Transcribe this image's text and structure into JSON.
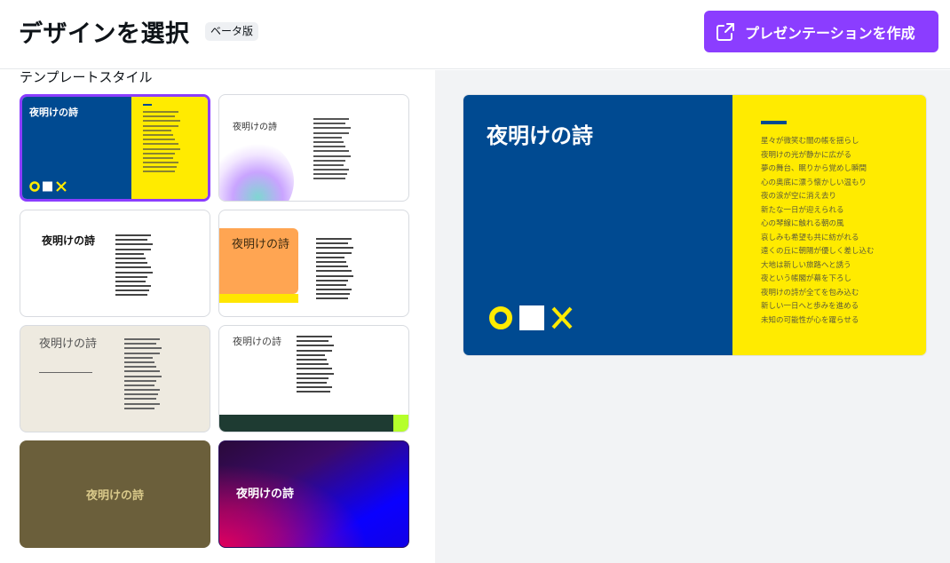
{
  "header": {
    "title": "デザインを選択",
    "beta_label": "ベータ版",
    "create_button_label": "プレゼンテーションを作成"
  },
  "left_panel": {
    "section_label": "テンプレートスタイル",
    "templates": [
      {
        "title": "夜明けの詩",
        "selected": true
      },
      {
        "title": "夜明けの詩",
        "selected": false
      },
      {
        "title": "夜明けの詩",
        "selected": false
      },
      {
        "title": "夜明けの詩",
        "selected": false
      },
      {
        "title": "夜明けの詩",
        "selected": false
      },
      {
        "title": "夜明けの詩",
        "selected": false
      },
      {
        "title": "夜明けの詩",
        "selected": false
      },
      {
        "title": "夜明けの詩",
        "selected": false
      }
    ]
  },
  "preview": {
    "title": "夜明けの詩",
    "lines": [
      "星々が微笑む闇の帳を揺らし",
      "夜明けの光が静かに広がる",
      "夢の舞台、眠りから覚めし瞬間",
      "心の奥底に漂う懐かしい温もり",
      "夜の涙が空に消え去り",
      "新たな一日が迎えられる",
      "心の琴線に触れる朝の風",
      "哀しみも希望も共に紡がれる",
      "遠くの丘に朝陽が優しく差し込む",
      "大地は新しい旅路へと誘う",
      "夜という帳閣が幕を下ろし",
      "夜明けの詩が全てを包み込む",
      "新しい一日へと歩みを進める",
      "未知の可能性が心を躍らせる"
    ]
  },
  "colors": {
    "accent": "#8b3dff",
    "navy": "#004a91",
    "yellow": "#ffeb00",
    "olive": "#6b5f3b",
    "dark_green": "#1e3b32",
    "lime": "#b5ff2b",
    "orange": "#ffa552",
    "cream": "#eeeae0"
  }
}
